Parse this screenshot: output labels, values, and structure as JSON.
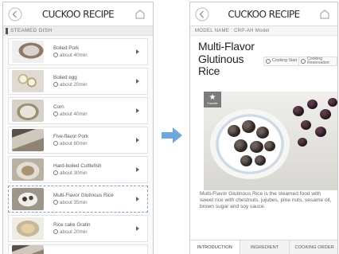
{
  "left_screen": {
    "header": {
      "title": "CUCKOO RECIPE"
    },
    "section_label": "STEAMED DISH",
    "items": [
      {
        "name": "Boiled Pork",
        "time": "about 40min"
      },
      {
        "name": "Boiled egg",
        "time": "about 20min"
      },
      {
        "name": "Corn",
        "time": "about 40min"
      },
      {
        "name": "Five-flavor Pork",
        "time": "about 60min"
      },
      {
        "name": "Hard-boiled Cuttlefish",
        "time": "about 30min"
      },
      {
        "name": "Multi-Flavor Glutinous Rice",
        "time": "about 35min"
      },
      {
        "name": "Rice cake Gratin",
        "time": "about 20min"
      }
    ],
    "selected_index": 5
  },
  "right_screen": {
    "header": {
      "title": "CUCKOO RECIPE"
    },
    "model_name": "MODEL NAME : CRP-AH Model",
    "recipe_title": "Multi-Flavor Glutinous Rice",
    "chip_start": "Cooking Start",
    "chip_reserve": "Cooking Reservation",
    "favorite_label": "Favorite",
    "description": "Multi-Flavor Glutinous Rice is the steamed food with sweet rice with chestnuts, jujubes, pine nuts, sesame oil, brown sugar and soy sauce.",
    "tabs": [
      "INTRODUCTION",
      "INGREDIENT",
      "COOKING ORDER"
    ],
    "active_tab": 0
  },
  "colors": {
    "arrow": "#6fa7dd",
    "selected_border": "#7ea3c9",
    "badge": "#7b7b7b"
  },
  "icons": [
    "back-arrow-icon",
    "home-icon",
    "clock-icon",
    "chevron-right-icon",
    "star-icon",
    "right-arrow-icon"
  ]
}
